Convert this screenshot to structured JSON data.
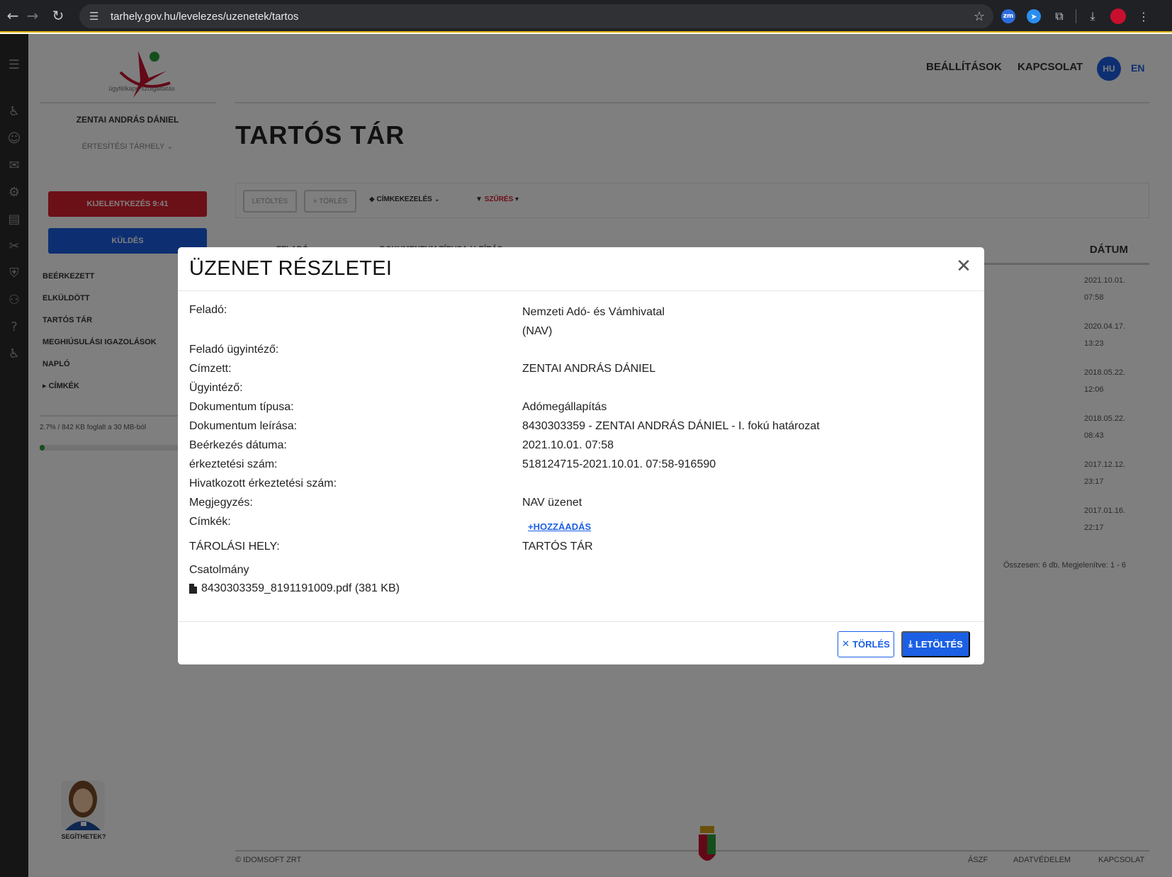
{
  "browser": {
    "url": "tarhely.gov.hu/levelezes/uzenetek/tartos",
    "extensions": [
      "zm"
    ]
  },
  "sidebar": {
    "logo_caption": "ügyfélkapu szolgáltatás",
    "user_name": "ZENTAI ANDRÁS DÁNIEL",
    "storage_selector": "ÉRTESÍTÉSI TÁRHELY",
    "logout_label": "KIJELENTKEZÉS 9:41",
    "send_label": "KÜLDÉS",
    "folders": [
      {
        "label": "BEÉRKEZETT"
      },
      {
        "label": "ELKÜLDÖTT"
      },
      {
        "label": "TARTÓS TÁR"
      },
      {
        "label": "MEGHIÚSULÁSI IGAZOLÁSOK"
      },
      {
        "label": "NAPLÓ"
      },
      {
        "label": "▸ CÍMKÉK"
      }
    ],
    "quota_text": "2.7% / 842 KB foglalt a 30 MB-ból",
    "quota_fraction": 0.027
  },
  "header": {
    "settings": "BEÁLLÍTÁSOK",
    "contact": "KAPCSOLAT",
    "lang_active": "HU",
    "lang_other": "EN"
  },
  "main": {
    "title": "TARTÓS TÁR",
    "toolbar": {
      "download": "LETÖLTÉS",
      "delete": "× TÖRLÉS",
      "tags": "CÍMKEKEZELÉS",
      "filter": "SZŰRÉS"
    },
    "columns": {
      "sender": "FELADÓ",
      "doc": "DOKUMENTUM TÍPUSA / LEÍRÁS",
      "date": "DÁTUM"
    },
    "rows": [
      {
        "date": "2021.10.01.",
        "time": "07:58"
      },
      {
        "date": "2020.04.17.",
        "time": "13:23"
      },
      {
        "date": "2018.05.22.",
        "time": "12:06"
      },
      {
        "date": "2018.05.22.",
        "time": "08:43"
      },
      {
        "date": "2017.12.12.",
        "time": "23:17"
      },
      {
        "date": "2017.01.16.",
        "time": "22:17"
      }
    ],
    "pager": "Összesen: 6 db, Megjelenítve: 1 - 6"
  },
  "footer": {
    "copyright": "© IDOMSOFT ZRT",
    "aszf": "ÁSZF",
    "privacy": "ADATVÉDELEM",
    "contact": "KAPCSOLAT"
  },
  "helper_label": "SEGÍTHETEK?",
  "modal": {
    "title": "ÜZENET RÉSZLETEI",
    "fields": {
      "sender_label": "Feladó:",
      "sender_value_1": "Nemzeti Adó- és Vámhivatal",
      "sender_value_2": "(NAV)",
      "sender_officer_label": "Feladó ügyintéző:",
      "recipient_label": "Címzett:",
      "recipient_value": "ZENTAI ANDRÁS DÁNIEL",
      "officer_label": "Ügyintéző:",
      "doc_type_label": "Dokumentum típusa:",
      "doc_type_value": "Adómegállapítás",
      "doc_desc_label": "Dokumentum leírása:",
      "doc_desc_value": "8430303359 - ZENTAI ANDRÁS DÁNIEL - I. fokú határozat",
      "received_label": "Beérkezés dátuma:",
      "received_value": "2021.10.01. 07:58",
      "reg_no_label": "érkeztetési szám:",
      "reg_no_value": "518124715-2021.10.01. 07:58-916590",
      "ref_reg_no_label": "Hivatkozott érkeztetési szám:",
      "note_label": "Megjegyzés:",
      "note_value": "NAV üzenet",
      "tags_label": "Címkék:",
      "add_tag": "+HOZZÁADÁS",
      "storage_label": "TÁROLÁSI HELY:",
      "storage_value": "TARTÓS TÁR",
      "attachment_label": "Csatolmány",
      "attachment_file": "8430303359_8191191009.pdf (381 KB)"
    },
    "delete_label": "TÖRLÉS",
    "download_label": "LETÖLTÉS"
  }
}
